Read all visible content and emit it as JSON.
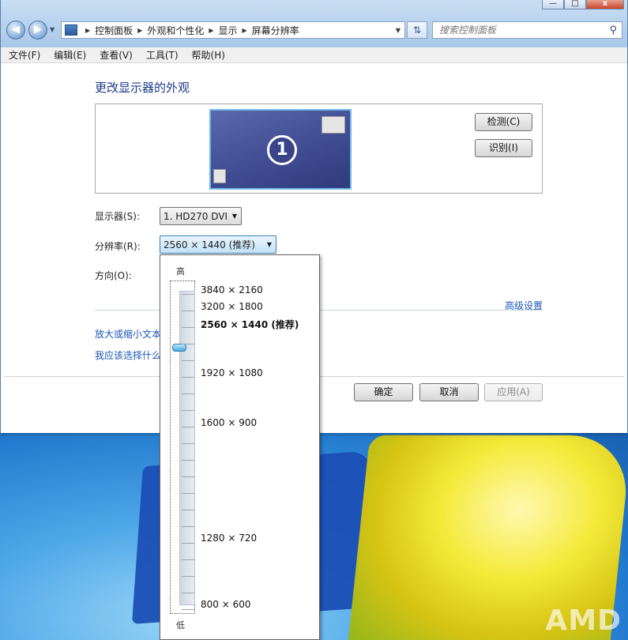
{
  "window": {
    "caption_buttons": [
      "—",
      "□",
      "x"
    ]
  },
  "address": {
    "crumbs": [
      "控制面板",
      "外观和个性化",
      "显示",
      "屏幕分辨率"
    ]
  },
  "search": {
    "placeholder": "搜索控制面板"
  },
  "menu": [
    "文件(F)",
    "编辑(E)",
    "查看(V)",
    "工具(T)",
    "帮助(H)"
  ],
  "main": {
    "heading": "更改显示器的外观",
    "monitor_number": "1",
    "detect_label": "检测(C)",
    "identify_label": "识别(I)",
    "display_label": "显示器(S):",
    "display_value": "1. HD270 DVI",
    "resolution_label": "分辨率(R):",
    "resolution_value": "2560 × 1440 (推荐)",
    "orientation_label": "方向(O):",
    "advanced_link": "高级设置",
    "zoom_link": "放大或缩小文本",
    "which_link": "我应该选择什么",
    "ok_label": "确定",
    "cancel_label": "取消",
    "apply_label": "应用(A)"
  },
  "resolution_popup": {
    "high_label": "高",
    "low_label": "低",
    "options": [
      "3840 × 2160",
      "3200 × 1800",
      "2560 × 1440 (推荐)",
      "1920 × 1080",
      "1600 × 900",
      "1280 × 720",
      "800 × 600"
    ],
    "selected": "2560 × 1440 (推荐)"
  },
  "desktop": {
    "brand": "AMD"
  }
}
